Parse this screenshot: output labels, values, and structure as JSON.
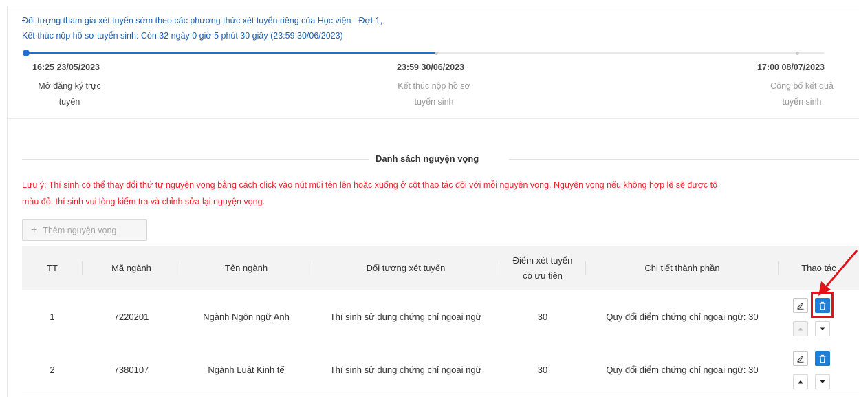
{
  "header": {
    "line1": "Đối tượng tham gia xét tuyển sớm theo các phương thức xét tuyển riêng của Học viện - Đợt 1,",
    "line2": "Kết thúc nộp hồ sơ tuyển sinh: Còn 32 ngày 0 giờ 5 phút 30 giây (23:59 30/06/2023)"
  },
  "timeline": {
    "steps": [
      {
        "date": "16:25 23/05/2023",
        "desc_line1": "Mở đăng ký trực",
        "desc_line2": "tuyến"
      },
      {
        "date": "23:59 30/06/2023",
        "desc_line1": "Kết thúc nộp hồ sơ",
        "desc_line2": "tuyển sinh"
      },
      {
        "date": "17:00 08/07/2023",
        "desc_line1": "Công bố kết quả",
        "desc_line2": "tuyển sinh"
      }
    ]
  },
  "section": {
    "title": "Danh sách nguyện vọng",
    "note_line1": "Lưu ý: Thí sinh có thể thay đổi thứ tự nguyện vọng bằng cách click vào nút mũi tên lên hoặc xuống ở cột thao tác đối với mỗi nguyện vọng. Nguyện vọng nếu không hợp lệ sẽ được tô",
    "note_line2": "màu đỏ, thí sinh vui lòng kiểm tra và chỉnh sửa lại nguyện vọng.",
    "add_button": "Thêm nguyện vọng"
  },
  "table": {
    "headers": {
      "tt": "TT",
      "ma_nganh": "Mã ngành",
      "ten_nganh": "Tên ngành",
      "doi_tuong": "Đối tượng xét tuyển",
      "diem_line1": "Điểm xét tuyển",
      "diem_line2": "có ưu tiên",
      "chi_tiet": "Chi tiết thành phần",
      "thao_tac": "Thao tác"
    },
    "rows": [
      {
        "tt": "1",
        "ma_nganh": "7220201",
        "ten_nganh": "Ngành Ngôn ngữ Anh",
        "doi_tuong": "Thí sinh sử dụng chứng chỉ ngoại ngữ",
        "diem": "30",
        "chi_tiet": "Quy đổi điểm chứng chỉ ngoại ngữ: 30"
      },
      {
        "tt": "2",
        "ma_nganh": "7380107",
        "ten_nganh": "Ngành Luật Kinh tế",
        "doi_tuong": "Thí sinh sử dụng chứng chỉ ngoại ngữ",
        "diem": "30",
        "chi_tiet": "Quy đổi điểm chứng chỉ ngoại ngữ: 30"
      }
    ]
  },
  "icons": {
    "edit": "pencil-icon",
    "delete": "trash-icon",
    "up": "caret-up-icon",
    "down": "caret-down-icon",
    "add": "plus-icon",
    "annotation": "red-arrow"
  },
  "colors": {
    "link_blue": "#1a62b8",
    "accent_blue": "#1f7fd6",
    "warning_red": "#e8262a",
    "highlight_red": "#e0141a"
  }
}
